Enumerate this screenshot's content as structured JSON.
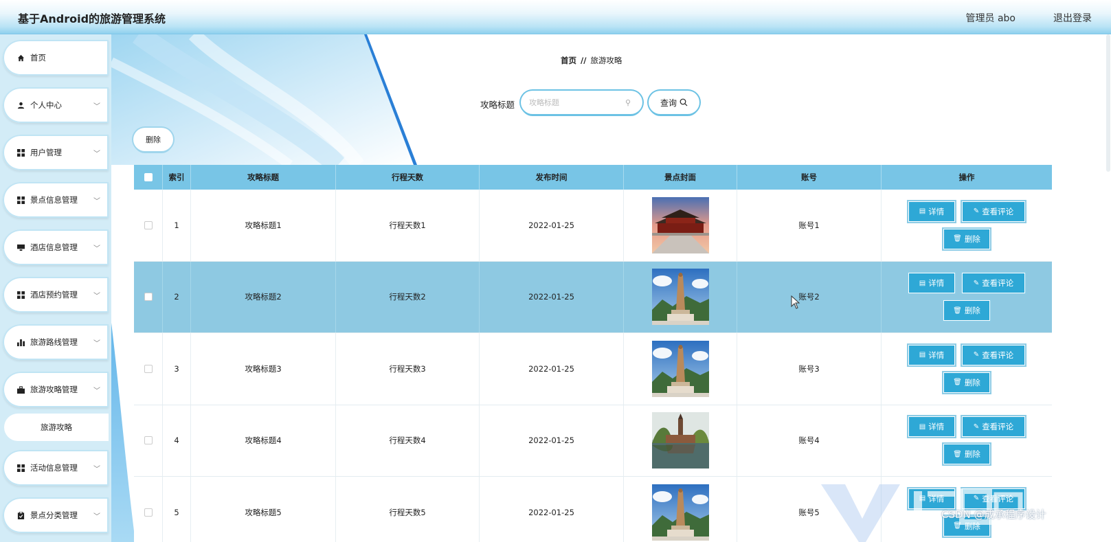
{
  "header": {
    "title": "基于Android的旅游管理系统",
    "admin": "管理员 abo",
    "logout": "退出登录"
  },
  "sidebar": {
    "items": [
      {
        "label": "首页",
        "icon": "home-icon",
        "has_chevron": false
      },
      {
        "label": "个人中心",
        "icon": "user-icon",
        "has_chevron": true
      },
      {
        "label": "用户管理",
        "icon": "grid-icon",
        "has_chevron": true
      },
      {
        "label": "景点信息管理",
        "icon": "grid-icon",
        "has_chevron": true
      },
      {
        "label": "酒店信息管理",
        "icon": "monitor-icon",
        "has_chevron": true
      },
      {
        "label": "酒店预约管理",
        "icon": "grid-icon",
        "has_chevron": true
      },
      {
        "label": "旅游路线管理",
        "icon": "bar-chart-icon",
        "has_chevron": true
      },
      {
        "label": "旅游攻略管理",
        "icon": "briefcase-icon",
        "has_chevron": true
      },
      {
        "label": "活动信息管理",
        "icon": "grid-icon",
        "has_chevron": true
      },
      {
        "label": "景点分类管理",
        "icon": "clipboard-icon",
        "has_chevron": true
      }
    ],
    "sub_item": "旅游攻略"
  },
  "breadcrumb": {
    "home": "首页",
    "separator": "//",
    "current": "旅游攻略"
  },
  "search": {
    "label": "攻略标题",
    "placeholder": "攻略标题",
    "value": "",
    "button": "查询"
  },
  "toolbar": {
    "delete_label": "删除"
  },
  "table": {
    "headers": [
      "索引",
      "攻略标题",
      "行程天数",
      "发布时间",
      "景点封面",
      "账号",
      "操作"
    ],
    "rows": [
      {
        "index": "1",
        "title": "攻略标题1",
        "days": "行程天数1",
        "date": "2022-01-25",
        "account": "账号1",
        "cover": "palace"
      },
      {
        "index": "2",
        "title": "攻略标题2",
        "days": "行程天数2",
        "date": "2022-01-25",
        "account": "账号2",
        "cover": "statue"
      },
      {
        "index": "3",
        "title": "攻略标题3",
        "days": "行程天数3",
        "date": "2022-01-25",
        "account": "账号3",
        "cover": "statue"
      },
      {
        "index": "4",
        "title": "攻略标题4",
        "days": "行程天数4",
        "date": "2022-01-25",
        "account": "账号4",
        "cover": "pagoda"
      },
      {
        "index": "5",
        "title": "攻略标题5",
        "days": "行程天数5",
        "date": "2022-01-25",
        "account": "账号5",
        "cover": "statue"
      }
    ],
    "selected_row_index": 1,
    "actions": {
      "detail": "详情",
      "comment": "查看评论",
      "delete": "删除"
    }
  },
  "watermark": "CSDN @成承程序设计",
  "colors": {
    "header_row": "#78c5e6",
    "action_button": "#2ea8d6",
    "selected_row": "#8ec9e2",
    "sidebar_bg": "#d3ecf7"
  }
}
